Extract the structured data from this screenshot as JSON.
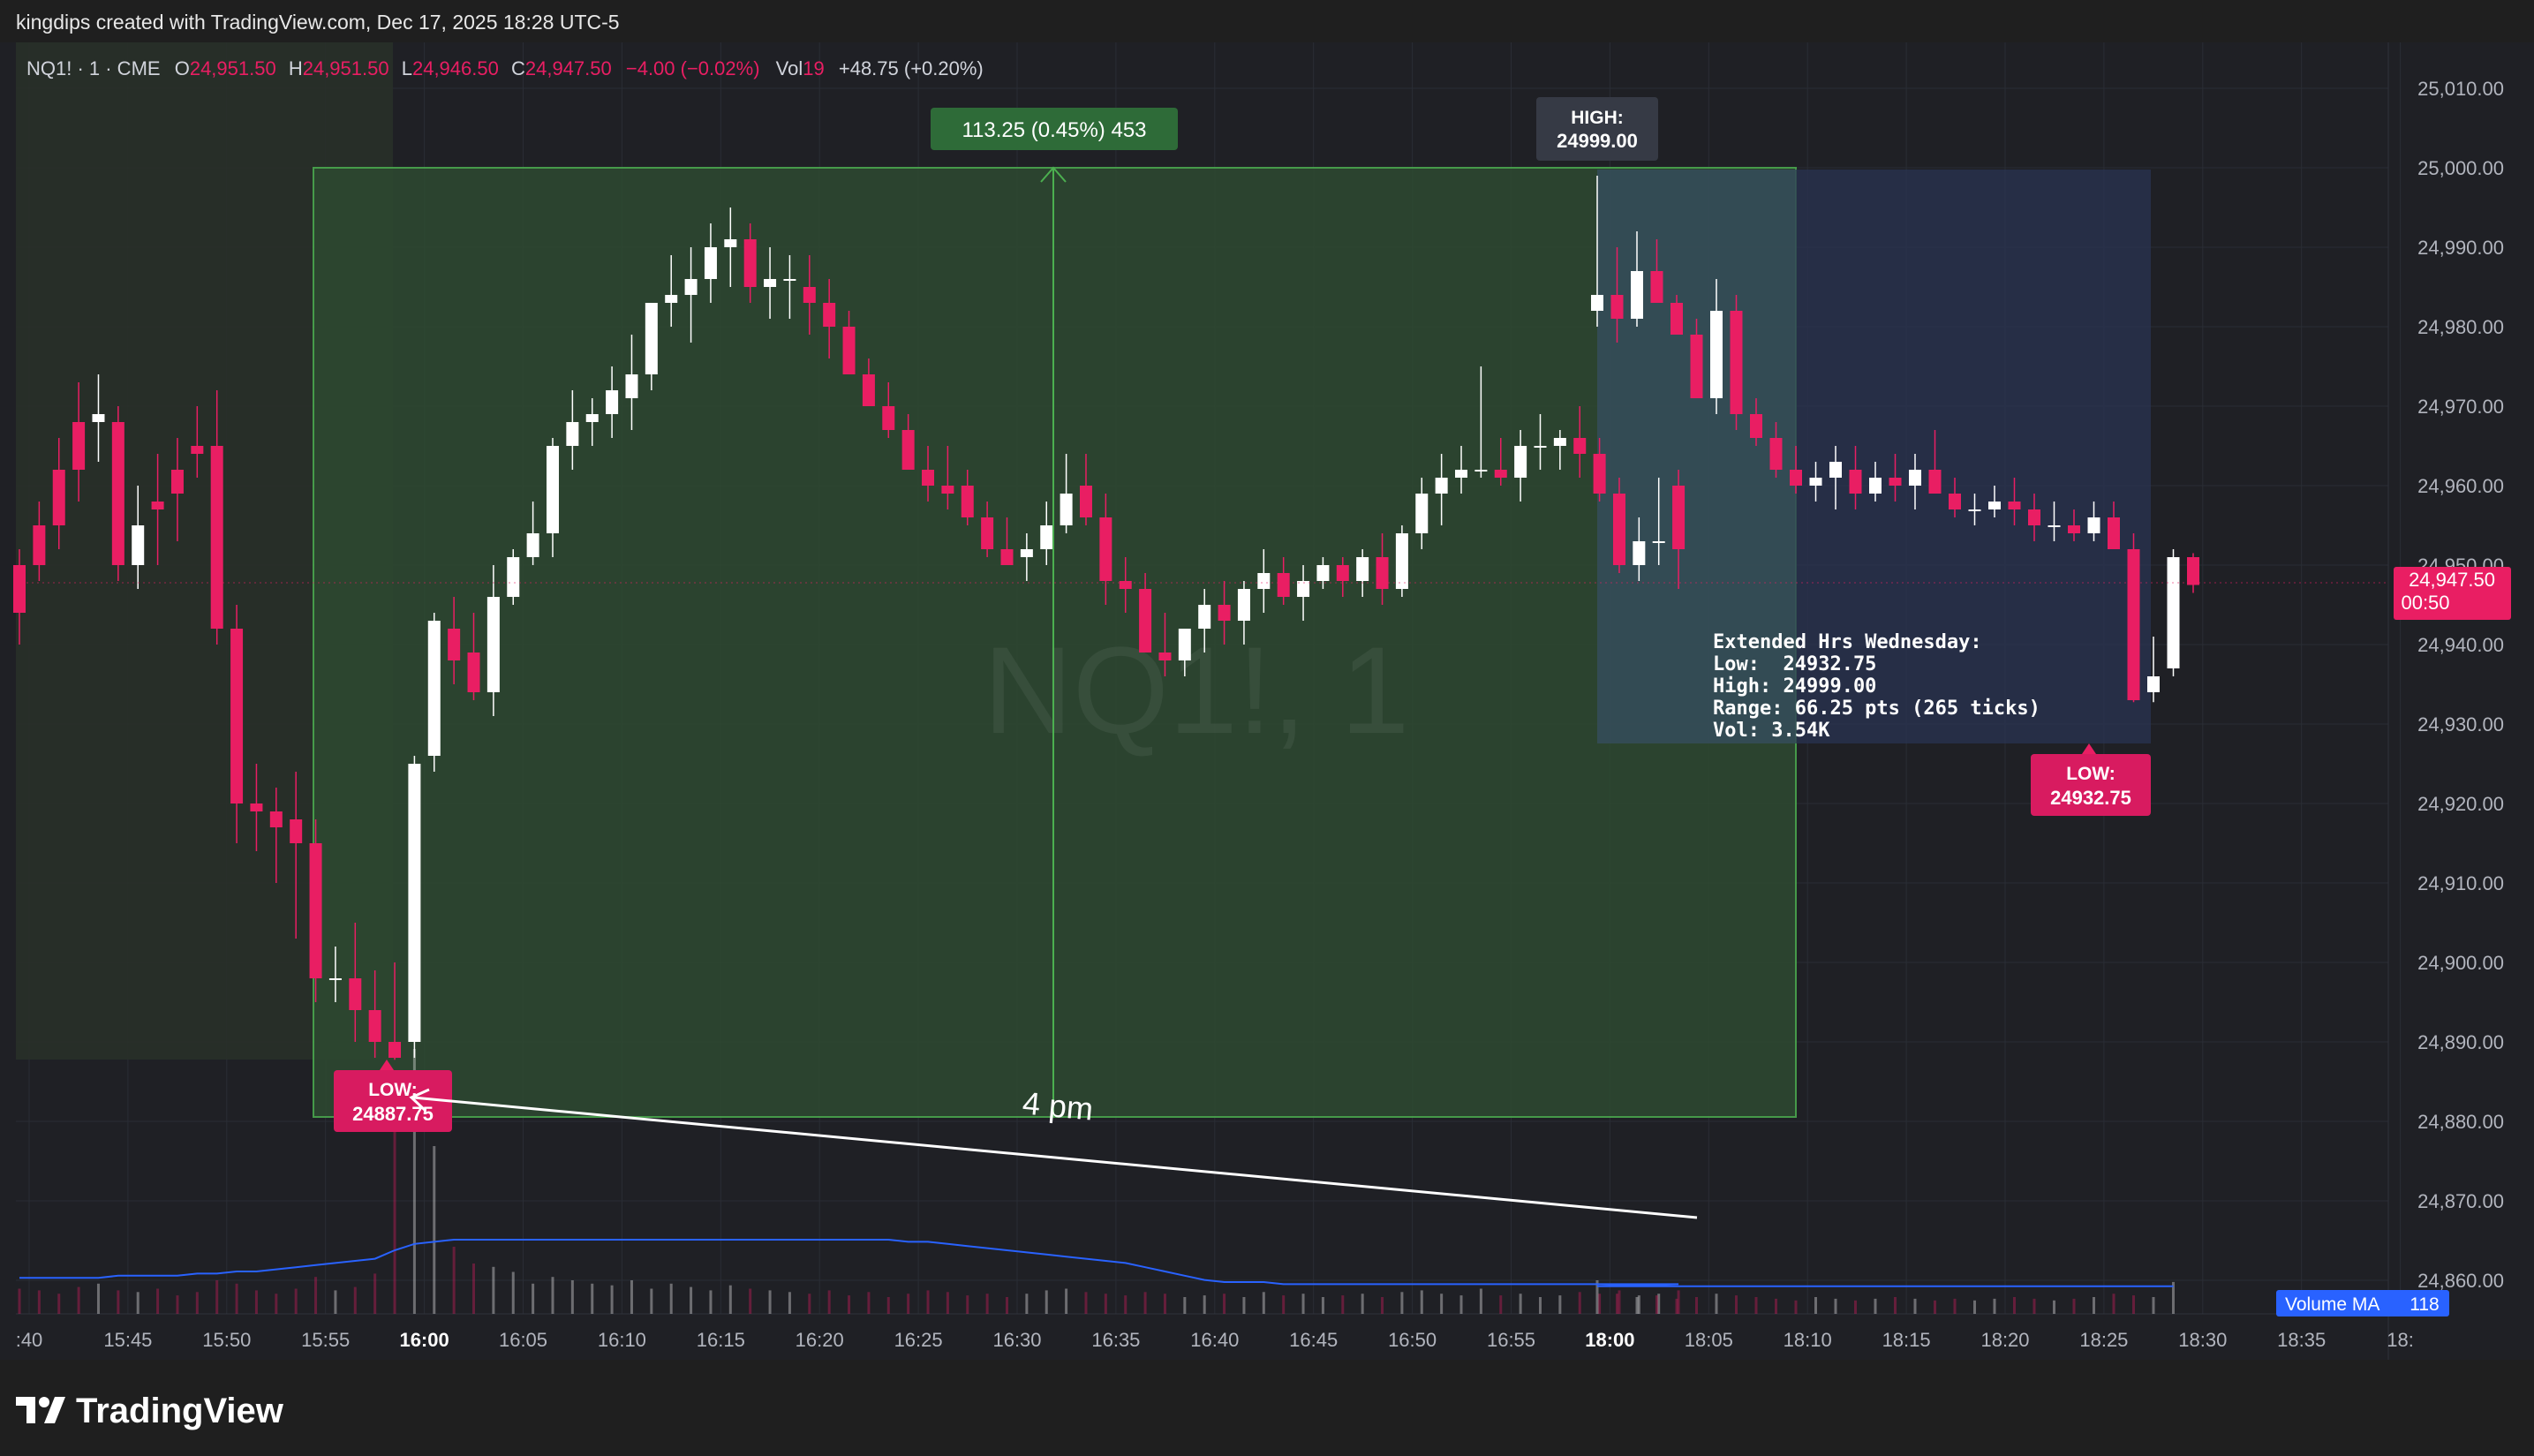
{
  "header": {
    "credit": "kingdips created with TradingView.com, Dec 17, 2025 18:28 UTC-5"
  },
  "legend": {
    "symbol": "NQ1! · 1 · CME",
    "o_label": "O",
    "o_value": "24,951.50",
    "h_label": "H",
    "h_value": "24,951.50",
    "l_label": "L",
    "l_value": "24,946.50",
    "c_label": "C",
    "c_value": "24,947.50",
    "change": "−4.00 (−0.02%)",
    "vol_label": "Vol",
    "vol_value": "19",
    "extra": "+48.75 (+0.20%)"
  },
  "watermark": "NQ1!, 1",
  "measure_label": "113.25 (0.45%) 453",
  "annotations": {
    "high_label": "HIGH:",
    "high_value": "24999.00",
    "low1_label": "LOW:",
    "low1_value": "24887.75",
    "low2_label": "LOW:",
    "low2_value": "24932.75",
    "arrow_text": "4 pm",
    "ext_lines": [
      "Extended Hrs Wednesday:",
      "Low:  24932.75",
      "High: 24999.00",
      "Range: 66.25 pts (265 ticks)",
      "Vol: 3.54K"
    ]
  },
  "price_badge": {
    "value": "24,947.50",
    "countdown": "00:50"
  },
  "volume_ma": {
    "label": "Volume MA",
    "value": "118"
  },
  "brand": {
    "name": "TradingView"
  },
  "colors": {
    "up": "#ffffff",
    "down": "#e91e63",
    "measure": "#4caf50",
    "ma_line": "#2962ff",
    "badge": "#e91e63",
    "high_box": "#363a45"
  },
  "chart_data": {
    "type": "candlestick",
    "title": "NQ1!, 1",
    "y_ticks": [
      "25,010.00",
      "25,000.00",
      "24,990.00",
      "24,980.00",
      "24,970.00",
      "24,960.00",
      "24,950.00",
      "24,940.00",
      "24,930.00",
      "24,920.00",
      "24,910.00",
      "24,900.00",
      "24,890.00",
      "24,880.00",
      "24,870.00",
      "24,860.00"
    ],
    "x_ticks": [
      ":40",
      "15:45",
      "15:50",
      "15:55",
      "16:00",
      "16:05",
      "16:10",
      "16:15",
      "16:20",
      "16:25",
      "16:30",
      "16:35",
      "16:40",
      "16:45",
      "16:50",
      "16:55",
      "18:00",
      "18:05",
      "18:10",
      "18:15",
      "18:20",
      "18:25",
      "18:30",
      "18:35",
      "18:"
    ],
    "bold_ticks": [
      "16:00",
      "18:00"
    ],
    "ylim": [
      24855,
      25015
    ],
    "candles": [
      [
        24950,
        24952,
        24940,
        24944
      ],
      [
        24955,
        24958,
        24948,
        24950
      ],
      [
        24962,
        24966,
        24952,
        24955
      ],
      [
        24968,
        24973,
        24958,
        24962
      ],
      [
        24968,
        24974,
        24963,
        24969
      ],
      [
        24968,
        24970,
        24948,
        24950
      ],
      [
        24950,
        24960,
        24947,
        24955
      ],
      [
        24958,
        24964,
        24950,
        24957
      ],
      [
        24962,
        24966,
        24953,
        24959
      ],
      [
        24965,
        24970,
        24961,
        24964
      ],
      [
        24965,
        24972,
        24940,
        24942
      ],
      [
        24942,
        24945,
        24915,
        24920
      ],
      [
        24920,
        24925,
        24914,
        24919
      ],
      [
        24919,
        24922,
        24910,
        24917
      ],
      [
        24918,
        24924,
        24903,
        24915
      ],
      [
        24915,
        24918,
        24895,
        24898
      ],
      [
        24898,
        24902,
        24895,
        24898
      ],
      [
        24898,
        24905,
        24890,
        24894
      ],
      [
        24894,
        24899,
        24888,
        24890
      ],
      [
        24890,
        24900,
        24887.75,
        24888
      ],
      [
        24890,
        24926,
        24888,
        24925
      ],
      [
        24926,
        24944,
        24924,
        24943
      ],
      [
        24942,
        24946,
        24935,
        24938
      ],
      [
        24939,
        24944,
        24933,
        24934
      ],
      [
        24934,
        24950,
        24931,
        24946
      ],
      [
        24946,
        24952,
        24945,
        24951
      ],
      [
        24951,
        24958,
        24950,
        24954
      ],
      [
        24954,
        24966,
        24951,
        24965
      ],
      [
        24965,
        24972,
        24962,
        24968
      ],
      [
        24968,
        24971,
        24965,
        24969
      ],
      [
        24969,
        24975,
        24966,
        24972
      ],
      [
        24971,
        24979,
        24967,
        24974
      ],
      [
        24974,
        24983,
        24972,
        24983
      ],
      [
        24983,
        24989,
        24980,
        24984
      ],
      [
        24984,
        24990,
        24978,
        24986
      ],
      [
        24986,
        24993,
        24983,
        24990
      ],
      [
        24990,
        24995,
        24985,
        24991
      ],
      [
        24991,
        24993,
        24983,
        24985
      ],
      [
        24985,
        24990,
        24981,
        24986
      ],
      [
        24986,
        24989,
        24981,
        24986
      ],
      [
        24985,
        24989,
        24979,
        24983
      ],
      [
        24983,
        24986,
        24976,
        24980
      ],
      [
        24980,
        24982,
        24974,
        24974
      ],
      [
        24974,
        24976,
        24970,
        24970
      ],
      [
        24970,
        24973,
        24966,
        24967
      ],
      [
        24967,
        24969,
        24962,
        24962
      ],
      [
        24962,
        24965,
        24958,
        24960
      ],
      [
        24960,
        24965,
        24957,
        24959
      ],
      [
        24960,
        24962,
        24955,
        24956
      ],
      [
        24956,
        24958,
        24951,
        24952
      ],
      [
        24952,
        24956,
        24950,
        24950
      ],
      [
        24951,
        24954,
        24948,
        24952
      ],
      [
        24952,
        24958,
        24950,
        24955
      ],
      [
        24955,
        24964,
        24954,
        24959
      ],
      [
        24960,
        24964,
        24955,
        24956
      ],
      [
        24956,
        24959,
        24945,
        24948
      ],
      [
        24948,
        24951,
        24944,
        24947
      ],
      [
        24947,
        24949,
        24939,
        24939
      ],
      [
        24939,
        24944,
        24936,
        24938
      ],
      [
        24938,
        24942,
        24936,
        24942
      ],
      [
        24942,
        24947,
        24939,
        24945
      ],
      [
        24945,
        24948,
        24940,
        24943
      ],
      [
        24943,
        24948,
        24940,
        24947
      ],
      [
        24947,
        24952,
        24944,
        24949
      ],
      [
        24949,
        24951,
        24945,
        24946
      ],
      [
        24946,
        24950,
        24943,
        24948
      ],
      [
        24948,
        24951,
        24947,
        24950
      ],
      [
        24950,
        24951,
        24946,
        24948
      ],
      [
        24948,
        24952,
        24946,
        24951
      ],
      [
        24951,
        24954,
        24945,
        24947
      ],
      [
        24947,
        24955,
        24946,
        24954
      ],
      [
        24954,
        24961,
        24952,
        24959
      ],
      [
        24959,
        24964,
        24955,
        24961
      ],
      [
        24961,
        24965,
        24959,
        24962
      ],
      [
        24962,
        24975,
        24961,
        24962
      ],
      [
        24962,
        24966,
        24960,
        24961
      ],
      [
        24961,
        24967,
        24958,
        24965
      ],
      [
        24965,
        24969,
        24962,
        24965
      ],
      [
        24965,
        24967,
        24962,
        24966
      ],
      [
        24966,
        24970,
        24961,
        24964
      ],
      [
        24964,
        24966,
        24958,
        24959
      ],
      [
        24959,
        24961,
        24949,
        24950
      ],
      [
        24950,
        24956,
        24948,
        24953
      ],
      [
        24953,
        24961,
        24950,
        24953
      ],
      [
        24960,
        24962,
        24947,
        24952
      ],
      [
        24982,
        24999,
        24980,
        24984
      ],
      [
        24984,
        24990,
        24978,
        24981
      ],
      [
        24981,
        24992,
        24980,
        24987
      ],
      [
        24987,
        24991,
        24983,
        24983
      ],
      [
        24983,
        24984,
        24980,
        24979
      ],
      [
        24979,
        24981,
        24971,
        24971
      ],
      [
        24971,
        24986,
        24969,
        24982
      ],
      [
        24982,
        24984,
        24967,
        24969
      ],
      [
        24969,
        24971,
        24965,
        24966
      ],
      [
        24966,
        24968,
        24961,
        24962
      ],
      [
        24962,
        24965,
        24959,
        24960
      ],
      [
        24960,
        24963,
        24958,
        24961
      ],
      [
        24961,
        24965,
        24957,
        24963
      ],
      [
        24962,
        24965,
        24957,
        24959
      ],
      [
        24959,
        24963,
        24958,
        24961
      ],
      [
        24961,
        24964,
        24958,
        24960
      ],
      [
        24960,
        24964,
        24957,
        24962
      ],
      [
        24962,
        24967,
        24959,
        24959
      ],
      [
        24959,
        24961,
        24956,
        24957
      ],
      [
        24957,
        24959,
        24955,
        24957
      ],
      [
        24957,
        24960,
        24956,
        24958
      ],
      [
        24958,
        24961,
        24955,
        24957
      ],
      [
        24957,
        24959,
        24953,
        24955
      ],
      [
        24955,
        24958,
        24953,
        24955
      ],
      [
        24955,
        24957,
        24953,
        24954
      ],
      [
        24954,
        24958,
        24953,
        24956
      ],
      [
        24956,
        24958,
        24952,
        24952
      ],
      [
        24952,
        24954,
        24932.75,
        24933
      ],
      [
        24934,
        24941,
        24932.75,
        24936
      ],
      [
        24937,
        24952,
        24936,
        24951
      ],
      [
        24951,
        24951.5,
        24946.5,
        24947.5
      ]
    ],
    "volumes": [
      15,
      14,
      12,
      16,
      18,
      14,
      13,
      15,
      11,
      13,
      20,
      18,
      14,
      12,
      15,
      22,
      14,
      16,
      24,
      140,
      160,
      100,
      40,
      30,
      28,
      25,
      18,
      22,
      20,
      18,
      17,
      20,
      15,
      18,
      16,
      14,
      17,
      15,
      14,
      13,
      12,
      14,
      11,
      13,
      10,
      12,
      14,
      13,
      11,
      12,
      10,
      12,
      14,
      15,
      13,
      12,
      11,
      13,
      12,
      10,
      11,
      12,
      10,
      13,
      11,
      12,
      10,
      11,
      12,
      10,
      13,
      14,
      12,
      11,
      15,
      11,
      12,
      10,
      11,
      13,
      12,
      14,
      11,
      12,
      14,
      20,
      12,
      10,
      11,
      9,
      10,
      12,
      11,
      10,
      9,
      8,
      10,
      9,
      8,
      9,
      10,
      9,
      8,
      9,
      8,
      9,
      10,
      9,
      8,
      9,
      10,
      12,
      11,
      10,
      19
    ],
    "ma": [
      17,
      17,
      17,
      17,
      17,
      18,
      18,
      18,
      18,
      19,
      19,
      20,
      20,
      21,
      22,
      23,
      24,
      25,
      26,
      30,
      33,
      34,
      35,
      35,
      35,
      35,
      35,
      35,
      35,
      35,
      35,
      35,
      35,
      35,
      35,
      35,
      35,
      35,
      35,
      35,
      35,
      35,
      35,
      35,
      35,
      34,
      34,
      33,
      32,
      31,
      30,
      29,
      28,
      27,
      26,
      25,
      24,
      22,
      20,
      18,
      16,
      15,
      15,
      15,
      14,
      14,
      14,
      14,
      14,
      14,
      14,
      14,
      14,
      14,
      14,
      14,
      14,
      14,
      14,
      14,
      14,
      14,
      14,
      14,
      14,
      13,
      13,
      13,
      13,
      13,
      13,
      13,
      13,
      13,
      13,
      13,
      13,
      13,
      13,
      13,
      13,
      13,
      13,
      13,
      13,
      13,
      13,
      13,
      13,
      13,
      13,
      13,
      13,
      13,
      13
    ]
  }
}
